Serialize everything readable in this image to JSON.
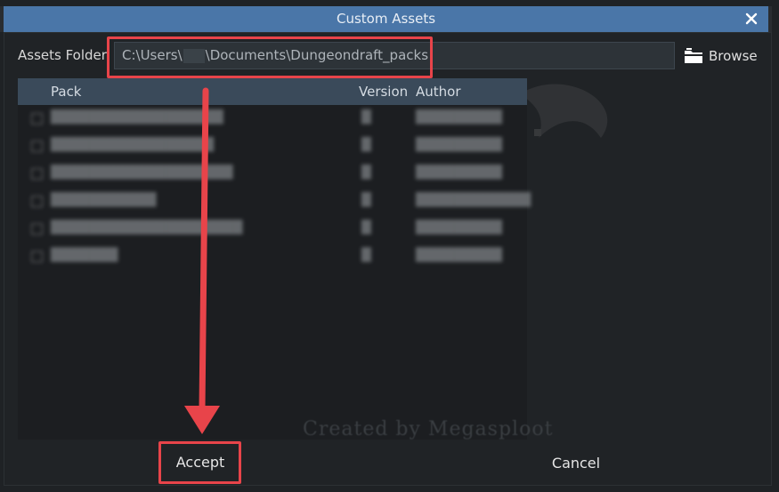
{
  "window": {
    "title": "Custom Assets"
  },
  "folder": {
    "label": "Assets Folder:",
    "path_prefix": "C:\\Users\\",
    "path_suffix": "\\Documents\\Dungeondraft_packs",
    "browse_label": "Browse"
  },
  "table": {
    "columns": {
      "pack": "Pack",
      "version": "Version",
      "author": "Author"
    }
  },
  "watermark": {
    "text": "Created by Megasploot"
  },
  "buttons": {
    "accept": "Accept",
    "cancel": "Cancel"
  },
  "colors": {
    "titlebar": "#4a76a8",
    "highlight": "#e8444a",
    "header": "#3a4a5a"
  }
}
